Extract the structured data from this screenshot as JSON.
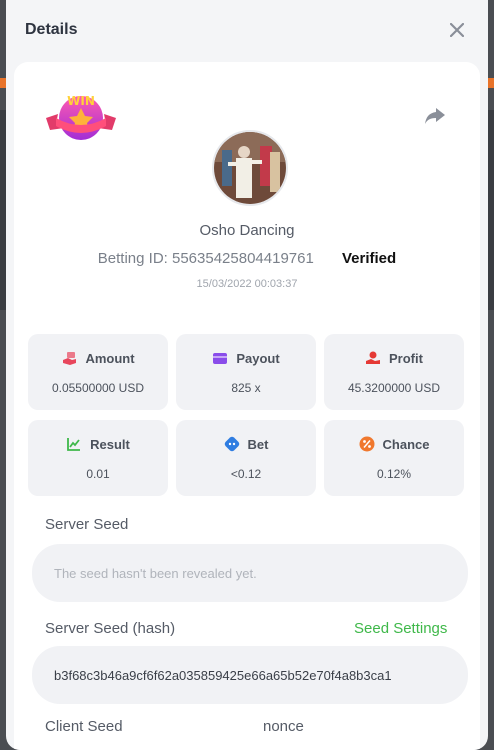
{
  "modal": {
    "title": "Details",
    "close_icon": "close-icon"
  },
  "game": {
    "name": "Osho Dancing",
    "betting_label": "Betting ID:",
    "betting_id": "556354258044197",
    "betting_suffix": "61",
    "verified": "Verified",
    "timestamp": "15/03/2022 00:03:37",
    "logo_text": "WIN"
  },
  "stats": [
    {
      "label": "Amount",
      "value": "0.05500000 USD",
      "icon": "money-hand-icon",
      "color": "#e8465c"
    },
    {
      "label": "Payout",
      "value": "825 x",
      "icon": "wallet-icon",
      "color": "#8a4dea"
    },
    {
      "label": "Profit",
      "value": "45.3200000 USD",
      "icon": "profit-icon",
      "color": "#e53935"
    },
    {
      "label": "Result",
      "value": "0.01",
      "icon": "chart-up-icon",
      "color": "#3fb84a"
    },
    {
      "label": "Bet",
      "value": "<0.12",
      "icon": "dice-icon",
      "color": "#2f7de1"
    },
    {
      "label": "Chance",
      "value": "0.12%",
      "icon": "percent-icon",
      "color": "#f0782e"
    }
  ],
  "server_seed": {
    "label": "Server Seed",
    "placeholder": "The seed hasn't been revealed yet."
  },
  "server_seed_hash": {
    "label": "Server Seed (hash)",
    "link": "Seed Settings",
    "value": "b3f68c3b46a9cf6f62a035859425e66a65b52e70f4a8b3ca1"
  },
  "client_seed": {
    "label": "Client Seed"
  },
  "nonce": {
    "label": "nonce"
  }
}
